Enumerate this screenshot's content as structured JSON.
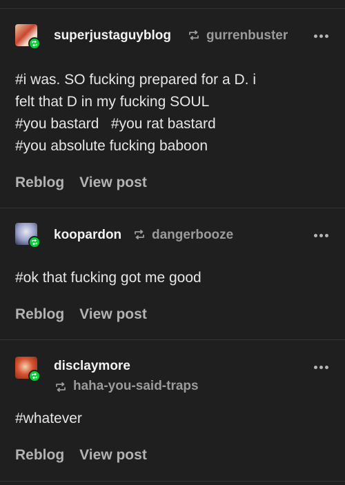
{
  "posts": [
    {
      "username": "superjustaguyblog",
      "reblogged_from": "gurrenbuster",
      "body_lines": [
        "#i was. SO fucking prepared for a D. i",
        "felt that D in my fucking SOUL",
        "#you bastard   #you rat bastard",
        "#you absolute fucking baboon"
      ],
      "actions": {
        "reblog": "Reblog",
        "view_post": "View post"
      }
    },
    {
      "username": "koopardon",
      "reblogged_from": "dangerbooze",
      "body_lines": [
        "#ok that fucking got me good"
      ],
      "actions": {
        "reblog": "Reblog",
        "view_post": "View post"
      }
    },
    {
      "username": "disclaymore",
      "reblogged_from": "haha-you-said-traps",
      "body_lines": [
        "#whatever"
      ],
      "actions": {
        "reblog": "Reblog",
        "view_post": "View post"
      }
    }
  ],
  "icons": {
    "reblog": "reblog-icon",
    "more": "more-options-icon",
    "badge": "reblog-badge-icon"
  },
  "colors": {
    "background": "#1f1f1f",
    "badge": "#00cf35"
  }
}
